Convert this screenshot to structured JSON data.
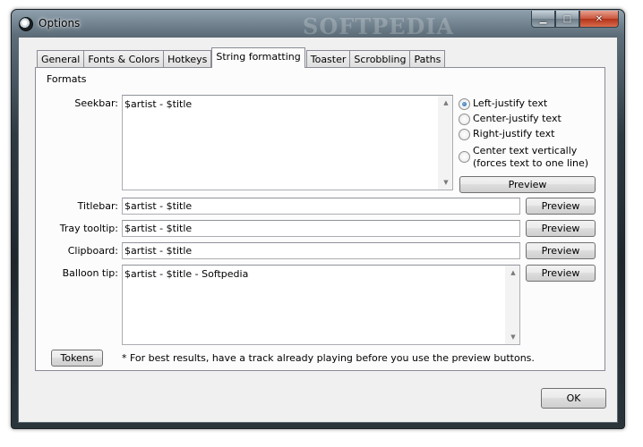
{
  "window": {
    "title": "Options",
    "watermark": "SOFTPEDIA"
  },
  "icons": {
    "app": "app-icon",
    "minimize": "minimize-icon",
    "maximize": "maximize-icon",
    "close": "close-icon"
  },
  "caption": {
    "minimize": "▁",
    "maximize": "□",
    "close": "✕"
  },
  "tabs": [
    {
      "label": "General",
      "active": false
    },
    {
      "label": "Fonts & Colors",
      "active": false
    },
    {
      "label": "Hotkeys",
      "active": false
    },
    {
      "label": "String formatting",
      "active": true
    },
    {
      "label": "Toaster",
      "active": false
    },
    {
      "label": "Scrobbling",
      "active": false
    },
    {
      "label": "Paths",
      "active": false
    }
  ],
  "formats": {
    "group_label": "Formats",
    "seekbar": {
      "label": "Seekbar:",
      "value": "$artist - $title"
    },
    "titlebar": {
      "label": "Titlebar:",
      "value": "$artist - $title"
    },
    "tray_tooltip": {
      "label": "Tray tooltip:",
      "value": "$artist - $title"
    },
    "clipboard": {
      "label": "Clipboard:",
      "value": "$artist - $title"
    },
    "balloon_tip": {
      "label": "Balloon tip:",
      "value": "$artist - $title - Softpedia"
    }
  },
  "justify": {
    "left": "Left-justify text",
    "center": "Center-justify text",
    "right": "Right-justify text",
    "vertical": "Center text vertically (forces text to one line)",
    "selected": "left"
  },
  "buttons": {
    "preview": "Preview",
    "tokens": "Tokens",
    "ok": "OK"
  },
  "note": "* For best results, have a track already playing before you use the preview buttons."
}
